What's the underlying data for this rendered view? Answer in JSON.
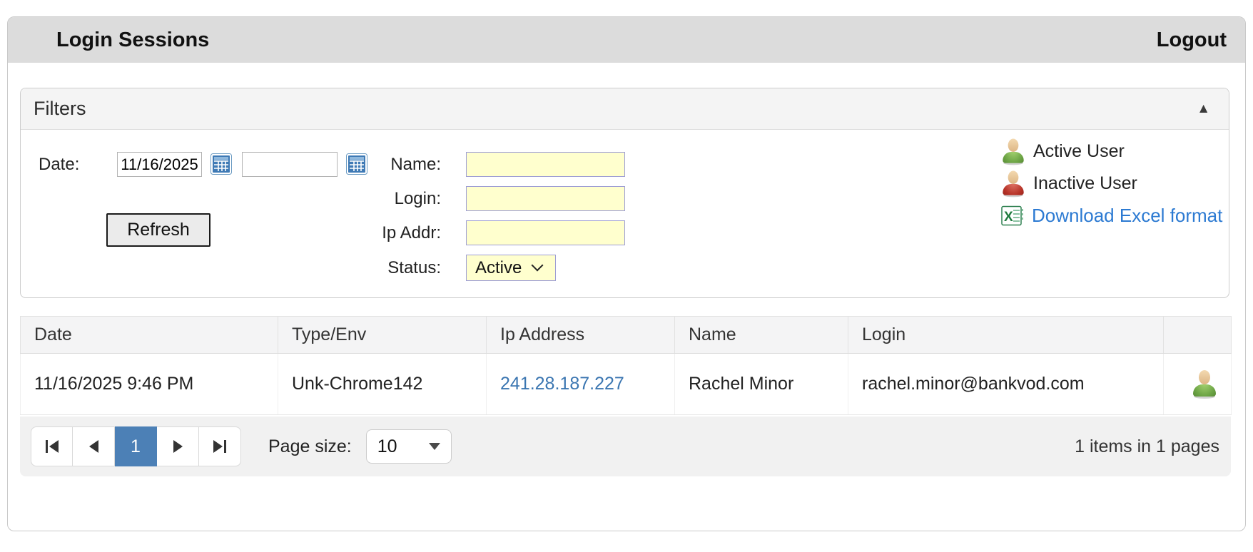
{
  "header": {
    "title": "Login Sessions",
    "logout_label": "Logout"
  },
  "filters": {
    "title": "Filters",
    "collapse_icon": "▲",
    "date_label": "Date:",
    "date_from": "11/16/2025",
    "date_to": "",
    "refresh_label": "Refresh",
    "name_label": "Name:",
    "login_label": "Login:",
    "ip_label": "Ip Addr:",
    "status_label": "Status:",
    "name_value": "",
    "login_value": "",
    "ip_value": "",
    "status_value": "Active",
    "legend": {
      "active_label": "Active User",
      "inactive_label": "Inactive User",
      "excel_label": "Download Excel format"
    }
  },
  "table": {
    "columns": [
      "Date",
      "Type/Env",
      "Ip Address",
      "Name",
      "Login",
      ""
    ],
    "rows": [
      {
        "date": "11/16/2025 9:46 PM",
        "type_env": "Unk-Chrome142",
        "ip": "241.28.187.227",
        "name": "Rachel Minor",
        "login": "rachel.minor@bankvod.com",
        "status": "active"
      }
    ]
  },
  "pagination": {
    "current_page": "1",
    "page_size_label": "Page size:",
    "page_size": "10",
    "summary": "1 items in 1 pages"
  },
  "colors": {
    "header_bar": "#dcdcdc",
    "filter_input_bg": "#ffffce",
    "filter_input_border": "#9e9ed4",
    "link_blue": "#2c7ad2",
    "ip_link_blue": "#3b76b1",
    "current_page_blue": "#4c80b6",
    "active_user_green": "#6ba344",
    "inactive_user_red": "#b63227"
  }
}
